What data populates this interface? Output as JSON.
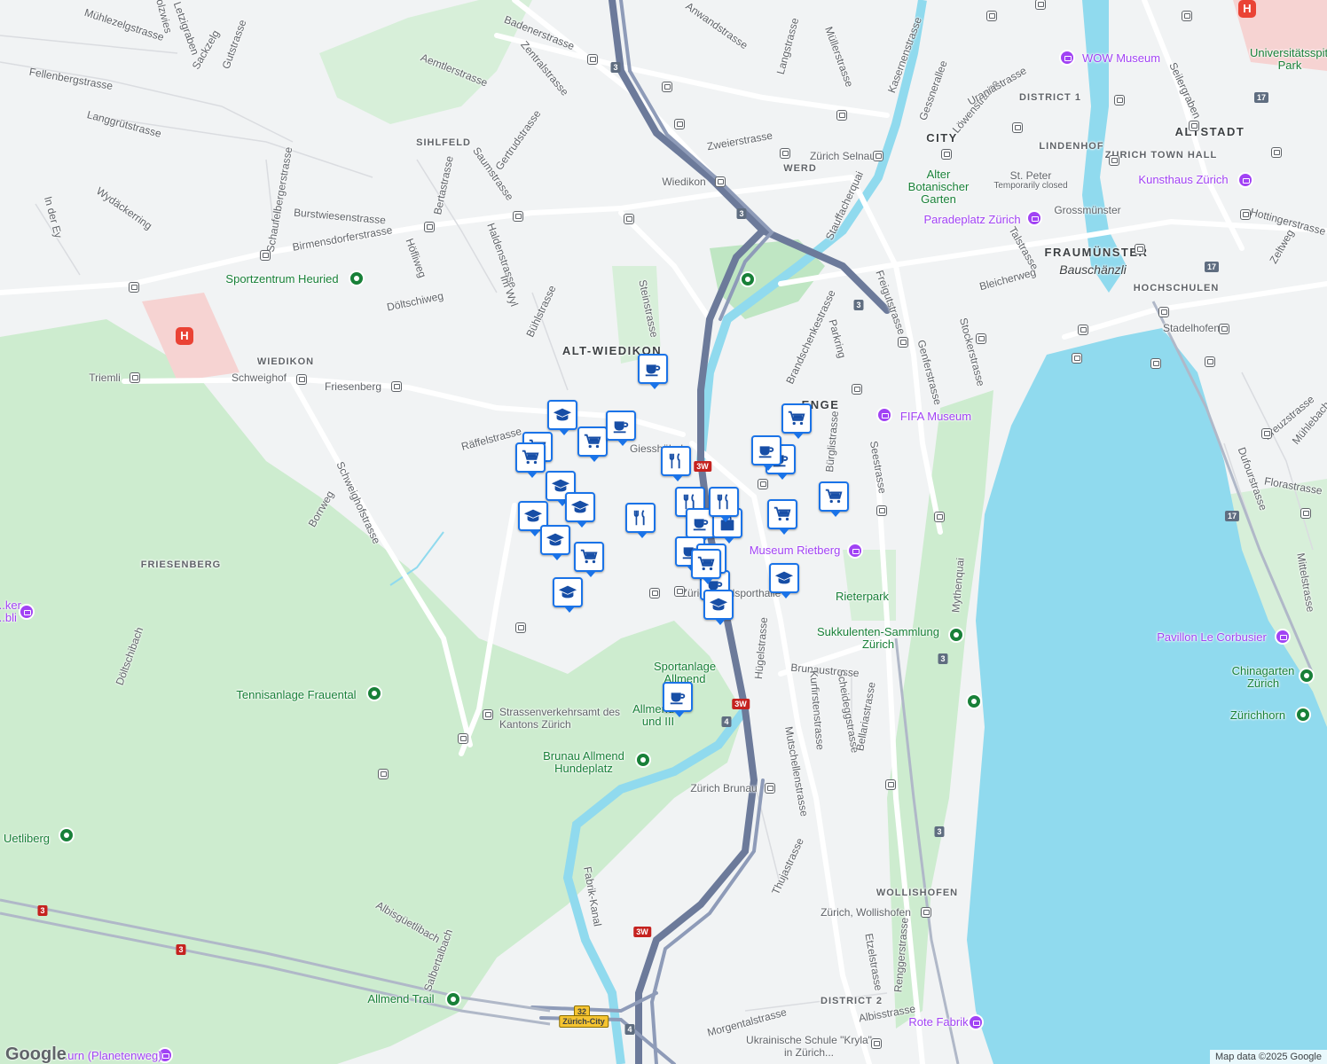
{
  "map": {
    "attribution": "Map data ©2025 Google",
    "logo": "Google",
    "colors": {
      "land": "#f1f3f4",
      "park": "#cdeccf",
      "water": "#90daee",
      "road": "#ffffff",
      "highway": "#6c7a9a",
      "pin_border": "#1a73e8",
      "poi_green": "#188038",
      "poi_purple": "#a142f4"
    }
  },
  "districts": [
    {
      "name": "ALT-WIEDIKON",
      "big": true
    },
    {
      "name": "ENGE",
      "big": true
    },
    {
      "name": "CITY",
      "big": true
    },
    {
      "name": "ALTSTADT",
      "big": true
    },
    {
      "name": "FRAUMÜNSTER",
      "big": true
    },
    {
      "name": "SIHLFELD",
      "big": false
    },
    {
      "name": "WERD",
      "big": false
    },
    {
      "name": "WIEDIKON",
      "big": false
    },
    {
      "name": "FRIESENBERG",
      "big": false
    },
    {
      "name": "LINDENHOF",
      "big": false
    },
    {
      "name": "DISTRICT 1",
      "big": false
    },
    {
      "name": "ZURICH TOWN HALL",
      "big": false
    },
    {
      "name": "HOCHSCHULEN",
      "big": false
    },
    {
      "name": "WOLLISHOFEN",
      "big": false
    },
    {
      "name": "DISTRICT 2",
      "big": false
    }
  ],
  "streets": [
    "Badenerstrasse",
    "Zentralstrasse",
    "Aemtlerstrasse",
    "Mühlezelgstrasse",
    "Letzigraben",
    "Sackzelg",
    "Gutstrasse",
    "Fellenbergstrasse",
    "Langgrütstrasse",
    "Gertrudstrasse",
    "Saumstrasse",
    "Bertastrasse",
    "Schaufelbergerstrasse",
    "Burstwiesenstrasse",
    "Birmensdorferstrasse",
    "Höfliweg",
    "Haldenstrasse",
    "Im Wyl",
    "Bühlstrasse",
    "Döltschiweg",
    "Steinstrasse",
    "Zweierstrasse",
    "Anwandstrasse",
    "Langstrasse",
    "Müllerstrasse",
    "Kasernenstrasse",
    "Gessnerallee",
    "Löwenstrasse",
    "Uraniastrasse",
    "Seilergraben",
    "Hottingerstrasse",
    "Zeltweg",
    "Stauffacherquai",
    "Talstrasse",
    "Bleicherweg",
    "Freigutstrasse",
    "Brandschenkestrasse",
    "Parkring",
    "Genferstrasse",
    "Stockerstrasse",
    "Bürglistrasse",
    "Seestrasse",
    "Mythenquai",
    "Räffelstrasse",
    "Schweighofstrasse",
    "Borrweg",
    "Hügelstrasse",
    "Brunaustrasse",
    "Kurfirstenstrasse",
    "Scheideggstrasse",
    "Bellariastrasse",
    "Mutschellenstrasse",
    "Thujastrasse",
    "Etzelstrasse",
    "Renggerstrasse",
    "Albisstrasse",
    "Morgentalstrasse",
    "Kreuzstrasse",
    "Dufourstrasse",
    "Florastrasse",
    "Mittelstrasse",
    "Fabrik-Kanal",
    "Albisgüetlibach",
    "Salbertalbach",
    "Döltschibach",
    "Wydäckerring",
    "In der Ey",
    "Holzwies",
    "Mühlebach"
  ],
  "places": [
    {
      "name": "WOW Museum",
      "kind": "museum"
    },
    {
      "name": "Universitätsspital Park",
      "kind": "hospital"
    },
    {
      "name": "Kunsthaus Zürich",
      "kind": "museum"
    },
    {
      "name": "St. Peter",
      "kind": "church",
      "note": "Temporarily closed"
    },
    {
      "name": "Grossmünster",
      "kind": "church"
    },
    {
      "name": "Paradeplatz Zürich",
      "kind": "shopping"
    },
    {
      "name": "Alter Botanischer Garten",
      "kind": "park"
    },
    {
      "name": "Zürich Selnau",
      "kind": "station"
    },
    {
      "name": "Wiedikon",
      "kind": "station"
    },
    {
      "name": "Sportzentrum Heuried",
      "kind": "park"
    },
    {
      "name": "Triemli",
      "kind": "station"
    },
    {
      "name": "Schweighof",
      "kind": "station"
    },
    {
      "name": "Friesenberg",
      "kind": "station"
    },
    {
      "name": "FIFA Museum",
      "kind": "museum"
    },
    {
      "name": "Bauschänzli",
      "kind": "landmark"
    },
    {
      "name": "Stadelhofen",
      "kind": "station"
    },
    {
      "name": "Museum Rietberg",
      "kind": "museum"
    },
    {
      "name": "Rieterpark",
      "kind": "park"
    },
    {
      "name": "Sukkulenten-Sammlung Zürich",
      "kind": "park"
    },
    {
      "name": "Pavillon Le Corbusier",
      "kind": "museum"
    },
    {
      "name": "Chinagarten Zürich",
      "kind": "park"
    },
    {
      "name": "Zürichhorn",
      "kind": "park"
    },
    {
      "name": "Sportanlage Allmend",
      "kind": "park"
    },
    {
      "name": "Allmend II und III",
      "kind": "park"
    },
    {
      "name": "Tennisanlage Frauental",
      "kind": "park"
    },
    {
      "name": "Strassenverkehrsamt des Kantons Zürich",
      "kind": "government"
    },
    {
      "name": "Brunau Allmend Hundeplatz",
      "kind": "park"
    },
    {
      "name": "Zürich Brunau",
      "kind": "station"
    },
    {
      "name": "Uetliberg",
      "kind": "park"
    },
    {
      "name": "Allmend Trail",
      "kind": "park"
    },
    {
      "name": "Zürich, Wollishofen",
      "kind": "station"
    },
    {
      "name": "Rote Fabrik",
      "kind": "shopping"
    },
    {
      "name": "Ukrainische Schule \"Kryla\" in Zürich...",
      "kind": "school"
    },
    {
      "name": "...urn (Planetenweg)",
      "kind": "museum"
    },
    {
      "name": "...ker ...bli",
      "kind": "museum"
    },
    {
      "name": "Giesshübel",
      "kind": "station"
    },
    {
      "name": "Zürich Saalsporthalle",
      "kind": "station"
    }
  ],
  "shields": [
    "3",
    "3",
    "3",
    "3",
    "3W",
    "3W",
    "3W",
    "4",
    "4",
    "17",
    "17",
    "17",
    "3",
    "3",
    "3",
    "32",
    "Zürich-City"
  ],
  "pins": [
    {
      "icon": "cafe-icon"
    },
    {
      "icon": "school-icon"
    },
    {
      "icon": "shopping-cart-icon"
    },
    {
      "icon": "cafe-icon"
    },
    {
      "icon": "shopping-cart-icon"
    },
    {
      "icon": "shopping-cart-icon"
    },
    {
      "icon": "school-icon"
    },
    {
      "icon": "school-icon"
    },
    {
      "icon": "school-icon"
    },
    {
      "icon": "school-icon"
    },
    {
      "icon": "shopping-cart-icon"
    },
    {
      "icon": "school-icon"
    },
    {
      "icon": "restaurant-icon"
    },
    {
      "icon": "restaurant-icon"
    },
    {
      "icon": "restaurant-icon"
    },
    {
      "icon": "cafe-icon"
    },
    {
      "icon": "shopping-bag-icon"
    },
    {
      "icon": "cafe-icon"
    },
    {
      "icon": "cafe-icon"
    },
    {
      "icon": "cafe-icon"
    },
    {
      "icon": "school-icon"
    },
    {
      "icon": "shopping-cart-icon"
    },
    {
      "icon": "cafe-icon"
    },
    {
      "icon": "shopping-cart-icon"
    },
    {
      "icon": "shopping-cart-icon"
    },
    {
      "icon": "school-icon"
    },
    {
      "icon": "shopping-cart-icon"
    },
    {
      "icon": "cafe-icon"
    },
    {
      "icon": "restaurant-icon"
    },
    {
      "icon": "cafe-icon"
    }
  ]
}
